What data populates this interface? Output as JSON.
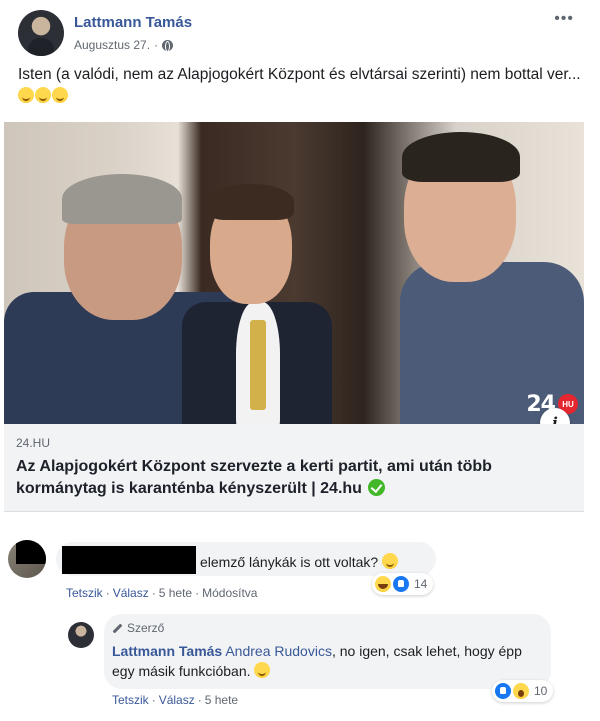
{
  "post": {
    "author": "Lattmann Tamás",
    "date": "Augusztus 27.",
    "separator": "·",
    "more_label": "•••",
    "text": "Isten (a valódi, nem az Alapjogokért Központ és elvtársai szerinti) nem bottal ver..."
  },
  "link": {
    "image_logo": "24",
    "image_badge": "HU",
    "info_label": "i",
    "domain": "24.HU",
    "title": "Az Alapjogokért Központ szervezte a kerti partit, ami után több kormánytag is karanténba kényszerült | 24.hu"
  },
  "comment": {
    "text": "elemző lánykák is ott voltak?",
    "reaction_count": "14",
    "actions": {
      "like": "Tetszik",
      "reply": "Válasz",
      "time": "5 hete",
      "edited": "Módosítva"
    }
  },
  "reply": {
    "author_badge": "Szerző",
    "author": "Lattmann Tamás",
    "mention": "Andrea Rudovics",
    "text": ", no igen, csak lehet, hogy épp egy másik funkcióban.",
    "reaction_count": "10",
    "actions": {
      "like": "Tetszik",
      "reply": "Válasz",
      "time": "5 hete"
    }
  },
  "colors": {
    "link_blue": "#385898",
    "meta_gray": "#606770",
    "bubble_bg": "#f2f3f5",
    "verified_green": "#42b72a",
    "brand_red": "#e5262f"
  },
  "icons": [
    "globe-icon",
    "more-icon",
    "emoji-icon",
    "info-icon",
    "verified-icon",
    "haha-icon",
    "like-icon",
    "wow-icon",
    "pen-icon"
  ]
}
